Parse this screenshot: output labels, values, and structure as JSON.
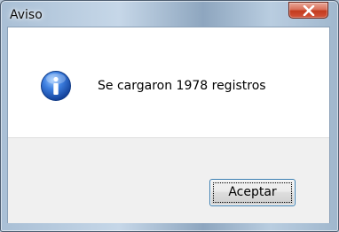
{
  "window": {
    "title": "Aviso"
  },
  "dialog": {
    "icon": "information-icon",
    "message": "Se cargaron 1978 registros",
    "ok_label": "Aceptar"
  },
  "colors": {
    "close_button": "#c8452a",
    "info_icon": "#1d5fc4",
    "footer": "#f0f0f0"
  }
}
